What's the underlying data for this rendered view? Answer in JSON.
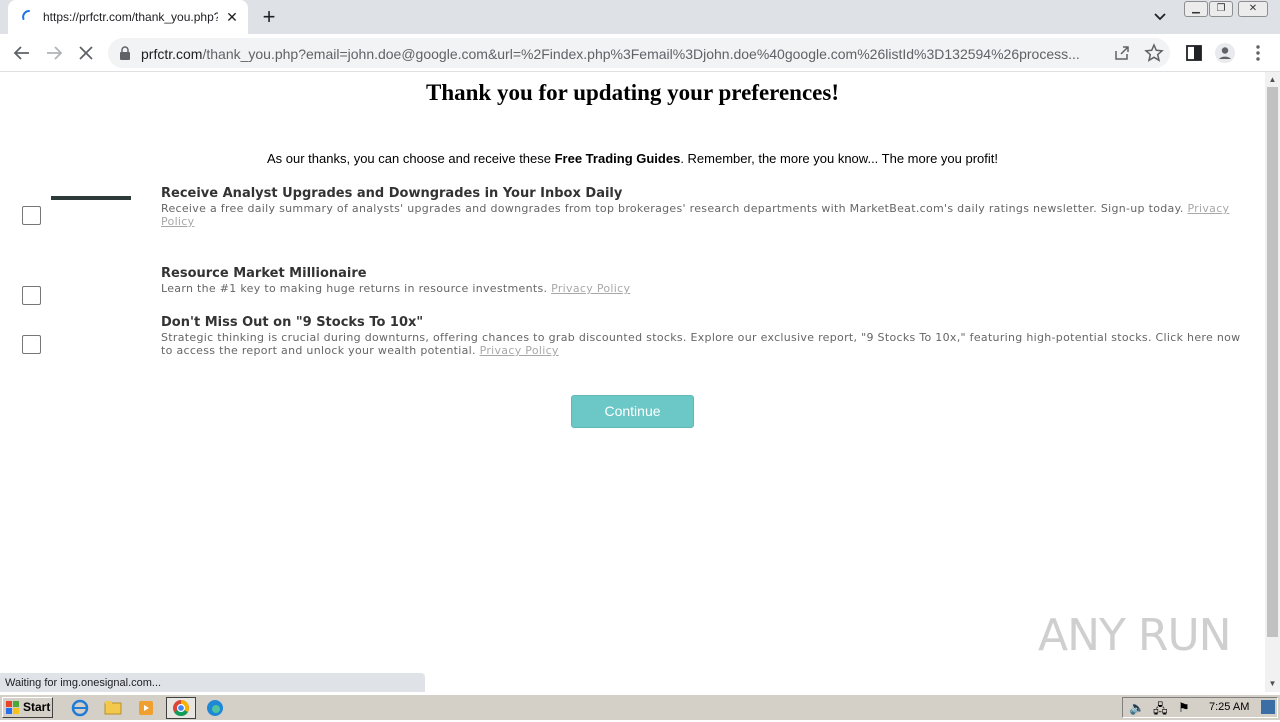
{
  "browser": {
    "tab_title": "https://prfctr.com/thank_you.php?e",
    "url_host": "prfctr.com",
    "url_path": "/thank_you.php?email=john.doe@google.com&url=%2Findex.php%3Femail%3Djohn.doe%40google.com%26listId%3D132594%26process...",
    "status_text": "Waiting for img.onesignal.com..."
  },
  "page": {
    "title": "Thank you for updating your preferences!",
    "intro_before": "As our thanks, you can choose and receive these ",
    "intro_bold": "Free Trading Guides",
    "intro_after": ". Remember, the more you know... The more you profit!",
    "offers": [
      {
        "title": "Receive Analyst Upgrades and Downgrades in Your Inbox Daily",
        "description": "Receive a free daily summary of analysts' upgrades and downgrades from top brokerages' research departments with MarketBeat.com's daily ratings newsletter. Sign-up today. ",
        "privacy": "Privacy Policy",
        "checked": false
      },
      {
        "title": "Resource Market Millionaire",
        "description": "Learn the #1 key to making huge returns in resource investments. ",
        "privacy": "Privacy Policy",
        "checked": false
      },
      {
        "title": "Don't Miss Out on \"9 Stocks To 10x\"",
        "description": "Strategic thinking is crucial during downturns, offering chances to grab discounted stocks. Explore our exclusive report, \"9 Stocks To 10x,\" featuring high-potential stocks. Click here now to access the report and unlock your wealth potential. ",
        "privacy": "Privacy Policy",
        "checked": false
      }
    ],
    "continue_label": "Continue",
    "watermark": "ANY RUN"
  },
  "taskbar": {
    "start_label": "Start",
    "clock": "7:25 AM"
  },
  "colors": {
    "continue_bg": "#6cc7c7",
    "tabstrip_bg": "#dee1e6",
    "omnibox_bg": "#f1f3f4",
    "taskbar_bg": "#d4d0c8"
  }
}
